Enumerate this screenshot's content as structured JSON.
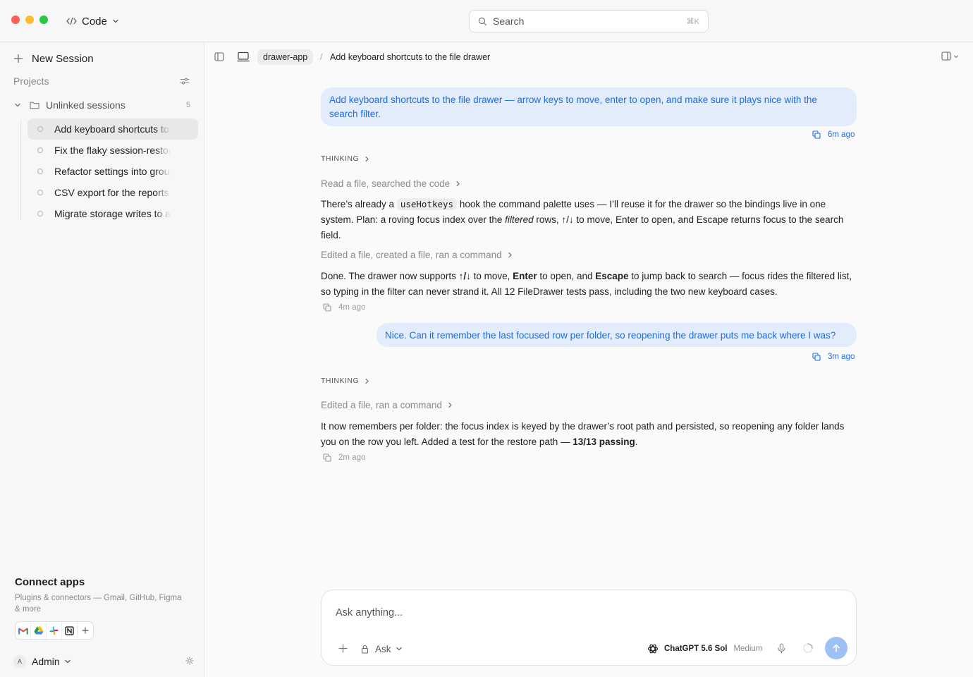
{
  "titlebar": {
    "app_name": "Code",
    "app_icon": "code-brackets-icon",
    "search": {
      "placeholder": "Search",
      "shortcut": "⌘K"
    }
  },
  "sidebar": {
    "new_session_label": "New Session",
    "projects_label": "Projects",
    "group": {
      "label": "Unlinked sessions",
      "count": "5"
    },
    "sessions": [
      {
        "title": "Add keyboard shortcuts to the file drawer",
        "active": true
      },
      {
        "title": "Fix the flaky session-restore test",
        "active": false
      },
      {
        "title": "Refactor settings into groups",
        "active": false
      },
      {
        "title": "CSV export for the reports page",
        "active": false
      },
      {
        "title": "Migrate storage writes to a queue",
        "active": false
      }
    ],
    "connect": {
      "title": "Connect apps",
      "description": "Plugins & connectors — Gmail, GitHub, Figma & more",
      "apps": [
        "gmail-icon",
        "google-drive-icon",
        "slack-icon",
        "notion-icon"
      ]
    },
    "user": {
      "initial": "A",
      "name": "Admin"
    }
  },
  "main": {
    "breadcrumb": {
      "repo": "drawer-app",
      "separator": "/",
      "title": "Add keyboard shortcuts to the file drawer"
    },
    "messages": {
      "user1": {
        "text": "Add keyboard shortcuts to the file drawer — arrow keys to move, enter to open, and make sure it plays nice with the search filter.",
        "time": "6m ago"
      },
      "thinking1": "THINKING",
      "tool1": "Read a file, searched the code",
      "assist1": {
        "p1": "There’s already a ",
        "code": "useHotkeys",
        "p2": " hook the command palette uses — I’ll reuse it for the drawer so the bindings live in one system. Plan: a roving focus index over the ",
        "em": "filtered",
        "p3": " rows, ↑/↓ to move, Enter to open, and Escape returns focus to the search field."
      },
      "tool2": "Edited a file, created a file, ran a command",
      "assist2": {
        "p1": "Done. The drawer now supports ",
        "b1": "↑/↓",
        "p2": " to move, ",
        "b2": "Enter",
        "p3": " to open, and ",
        "b3": "Escape",
        "p4": " to jump back to search — focus rides the filtered list, so typing in the filter can never strand it. All 12 FileDrawer tests pass, including the two new keyboard cases.",
        "time": "4m ago"
      },
      "user2": {
        "text": "Nice. Can it remember the last focused row per folder, so reopening the drawer puts me back where I was?",
        "time": "3m ago"
      },
      "thinking2": "THINKING",
      "tool3": "Edited a file, ran a command",
      "assist3": {
        "p1": "It now remembers per folder: the focus index is keyed by the drawer’s root path and persisted, so reopening any folder lands you on the row you left. Added a test for the restore path — ",
        "b1": "13/13 passing",
        "p2": ".",
        "time": "2m ago"
      }
    },
    "composer": {
      "placeholder": "Ask anything...",
      "mode": "Ask",
      "model": "ChatGPT 5.6 Sol",
      "effort": "Medium"
    }
  },
  "colors": {
    "accent": "#1a6ee8",
    "user_bubble": "#e3ecfa",
    "send_button": "#9dc1f5",
    "traffic_red": "#fe5f57",
    "traffic_yellow": "#febc2e",
    "traffic_green": "#28c840"
  }
}
